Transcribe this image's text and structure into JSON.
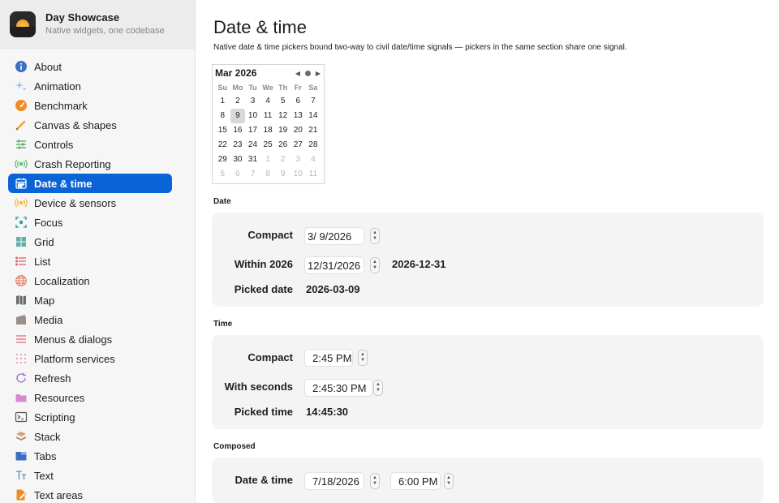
{
  "app": {
    "title": "Day Showcase",
    "subtitle": "Native widgets, one codebase"
  },
  "sidebar": {
    "items": [
      {
        "label": "About",
        "icon": "info-icon"
      },
      {
        "label": "Animation",
        "icon": "sparkles-icon"
      },
      {
        "label": "Benchmark",
        "icon": "speedometer-icon"
      },
      {
        "label": "Canvas & shapes",
        "icon": "pencil-icon"
      },
      {
        "label": "Controls",
        "icon": "sliders-icon"
      },
      {
        "label": "Crash Reporting",
        "icon": "broadcast-icon"
      },
      {
        "label": "Date & time",
        "icon": "calendar-icon",
        "active": true
      },
      {
        "label": "Device & sensors",
        "icon": "sensor-icon"
      },
      {
        "label": "Focus",
        "icon": "focus-icon"
      },
      {
        "label": "Grid",
        "icon": "grid-icon"
      },
      {
        "label": "List",
        "icon": "list-icon"
      },
      {
        "label": "Localization",
        "icon": "globe-icon"
      },
      {
        "label": "Map",
        "icon": "map-icon"
      },
      {
        "label": "Media",
        "icon": "film-icon"
      },
      {
        "label": "Menus & dialogs",
        "icon": "menu-icon"
      },
      {
        "label": "Platform services",
        "icon": "dots-grid-icon"
      },
      {
        "label": "Refresh",
        "icon": "refresh-icon"
      },
      {
        "label": "Resources",
        "icon": "folder-icon"
      },
      {
        "label": "Scripting",
        "icon": "terminal-icon"
      },
      {
        "label": "Stack",
        "icon": "stack-icon"
      },
      {
        "label": "Tabs",
        "icon": "tabs-icon"
      },
      {
        "label": "Text",
        "icon": "text-icon"
      },
      {
        "label": "Text areas",
        "icon": "document-edit-icon"
      }
    ]
  },
  "page": {
    "title": "Date & time",
    "description": "Native date & time pickers bound two-way to civil date/time signals — pickers in the same section share one signal."
  },
  "calendar": {
    "month_label": "Mar 2026",
    "prev": "◀",
    "next": "▶",
    "weekdays": [
      "Su",
      "Mo",
      "Tu",
      "We",
      "Th",
      "Fr",
      "Sa"
    ],
    "weeks": [
      [
        {
          "d": "1"
        },
        {
          "d": "2"
        },
        {
          "d": "3"
        },
        {
          "d": "4"
        },
        {
          "d": "5"
        },
        {
          "d": "6"
        },
        {
          "d": "7"
        }
      ],
      [
        {
          "d": "8"
        },
        {
          "d": "9",
          "sel": true
        },
        {
          "d": "10"
        },
        {
          "d": "11"
        },
        {
          "d": "12"
        },
        {
          "d": "13"
        },
        {
          "d": "14"
        }
      ],
      [
        {
          "d": "15"
        },
        {
          "d": "16"
        },
        {
          "d": "17"
        },
        {
          "d": "18"
        },
        {
          "d": "19"
        },
        {
          "d": "20"
        },
        {
          "d": "21"
        }
      ],
      [
        {
          "d": "22"
        },
        {
          "d": "23"
        },
        {
          "d": "24"
        },
        {
          "d": "25"
        },
        {
          "d": "26"
        },
        {
          "d": "27"
        },
        {
          "d": "28"
        }
      ],
      [
        {
          "d": "29"
        },
        {
          "d": "30"
        },
        {
          "d": "31"
        },
        {
          "d": "1",
          "m": true
        },
        {
          "d": "2",
          "m": true
        },
        {
          "d": "3",
          "m": true
        },
        {
          "d": "4",
          "m": true
        }
      ],
      [
        {
          "d": "5",
          "m": true
        },
        {
          "d": "6",
          "m": true
        },
        {
          "d": "7",
          "m": true
        },
        {
          "d": "8",
          "m": true
        },
        {
          "d": "9",
          "m": true
        },
        {
          "d": "10",
          "m": true
        },
        {
          "d": "11",
          "m": true
        }
      ]
    ]
  },
  "date_section": {
    "label": "Date",
    "compact_label": "Compact",
    "compact_value": "3/  9/2026",
    "within_label": "Within 2026",
    "within_value": "12/31/2026",
    "within_readout": "2026-12-31",
    "picked_label": "Picked date",
    "picked_value": "2026-03-09"
  },
  "time_section": {
    "label": "Time",
    "compact_label": "Compact",
    "compact_value": "2:45 PM",
    "seconds_label": "With seconds",
    "seconds_value": "2:45:30 PM",
    "picked_label": "Picked time",
    "picked_value": "14:45:30"
  },
  "composed_section": {
    "label": "Composed",
    "datetime_label": "Date & time",
    "date_value": "7/18/2026",
    "time_value": "6:00 PM"
  },
  "colors": {
    "accent": "#0a64d8",
    "sidebar_bg": "#f6f6f6",
    "card_bg": "#f4f4f4"
  }
}
